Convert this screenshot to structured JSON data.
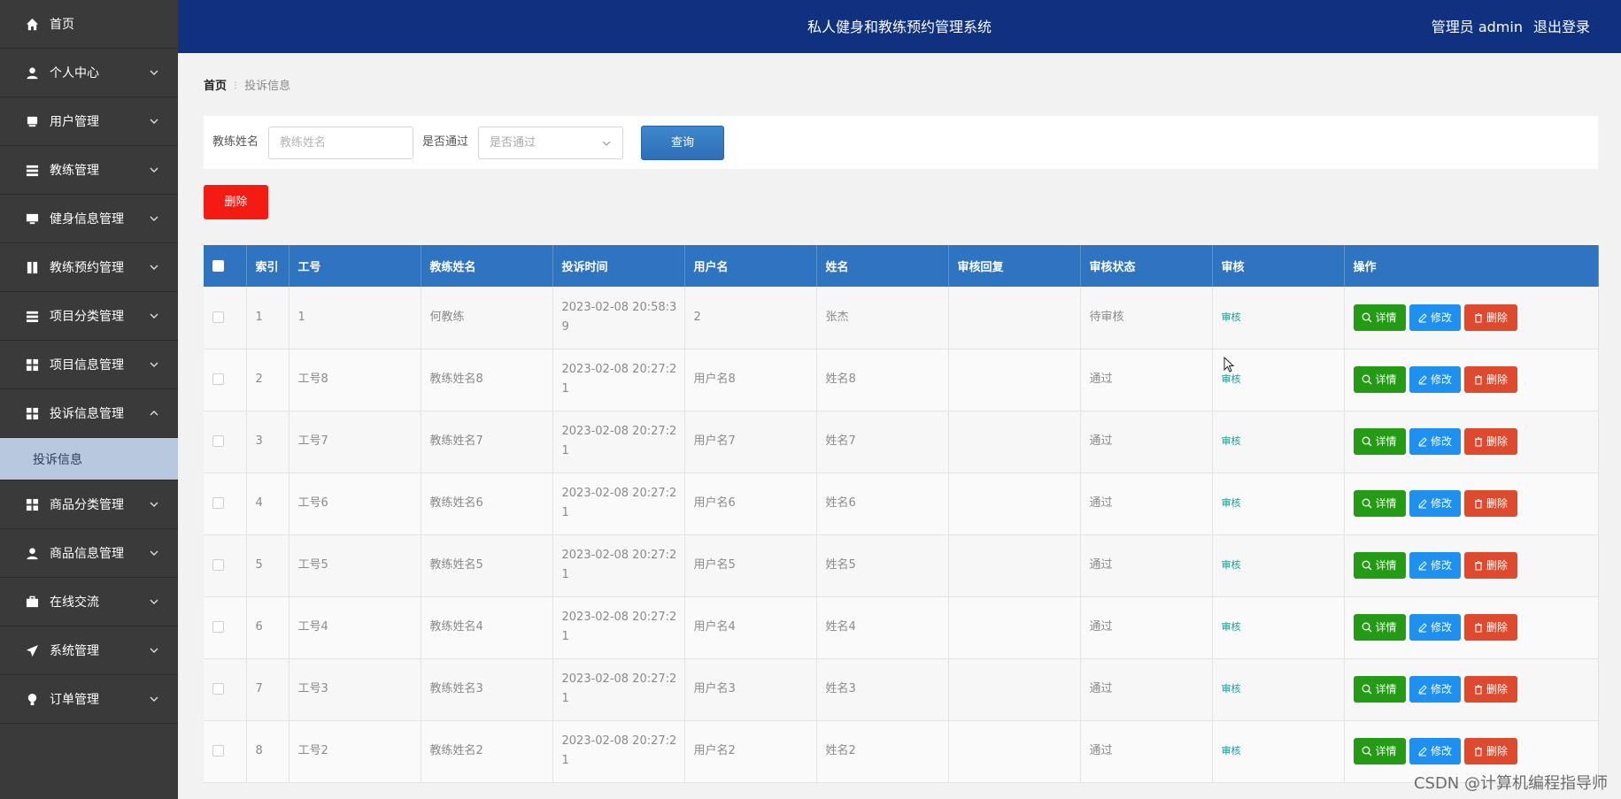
{
  "app": {
    "title": "私人健身和教练预约管理系统",
    "user_label": "管理员 admin",
    "logout_label": "退出登录"
  },
  "sidebar": {
    "items": [
      {
        "label": "首页",
        "icon": "home-icon",
        "has_chevron": false
      },
      {
        "label": "个人中心",
        "icon": "user-icon",
        "has_chevron": true,
        "chevron": "down"
      },
      {
        "label": "用户管理",
        "icon": "users-icon",
        "has_chevron": true,
        "chevron": "down"
      },
      {
        "label": "教练管理",
        "icon": "list-icon",
        "has_chevron": true,
        "chevron": "down"
      },
      {
        "label": "健身信息管理",
        "icon": "monitor-icon",
        "has_chevron": true,
        "chevron": "down"
      },
      {
        "label": "教练预约管理",
        "icon": "calendar-icon",
        "has_chevron": true,
        "chevron": "down"
      },
      {
        "label": "项目分类管理",
        "icon": "list-icon",
        "has_chevron": true,
        "chevron": "down"
      },
      {
        "label": "项目信息管理",
        "icon": "grid-icon",
        "has_chevron": true,
        "chevron": "down"
      },
      {
        "label": "投诉信息管理",
        "icon": "grid-icon",
        "has_chevron": true,
        "chevron": "up"
      },
      {
        "label": "投诉信息",
        "icon": "",
        "sub": true
      },
      {
        "label": "商品分类管理",
        "icon": "grid-icon",
        "has_chevron": true,
        "chevron": "down"
      },
      {
        "label": "商品信息管理",
        "icon": "user-icon",
        "has_chevron": true,
        "chevron": "down"
      },
      {
        "label": "在线交流",
        "icon": "briefcase-icon",
        "has_chevron": true,
        "chevron": "down"
      },
      {
        "label": "系统管理",
        "icon": "send-icon",
        "has_chevron": true,
        "chevron": "down"
      },
      {
        "label": "订单管理",
        "icon": "bulb-icon",
        "has_chevron": true,
        "chevron": "down"
      }
    ]
  },
  "breadcrumb": {
    "home": "首页",
    "current": "投诉信息"
  },
  "search": {
    "name_label": "教练姓名",
    "name_placeholder": "教练姓名",
    "pass_label": "是否通过",
    "pass_placeholder": "是否通过",
    "query_label": "查询"
  },
  "toolbar": {
    "delete_label": "删除"
  },
  "table": {
    "columns": [
      "",
      "索引",
      "工号",
      "教练姓名",
      "投诉时间",
      "用户名",
      "姓名",
      "审核回复",
      "审核状态",
      "审核",
      "操作"
    ],
    "audit_link": "审核",
    "actions": {
      "detail": "详情",
      "edit": "修改",
      "delete": "删除"
    },
    "rows": [
      {
        "index": "1",
        "job_no": "1",
        "coach": "何教练",
        "time_a": "2023-02-08 20:58:3",
        "time_b": "9",
        "username": "2",
        "name": "张杰",
        "reply": "",
        "status": "待审核"
      },
      {
        "index": "2",
        "job_no": "工号8",
        "coach": "教练姓名8",
        "time_a": "2023-02-08 20:27:2",
        "time_b": "1",
        "username": "用户名8",
        "name": "姓名8",
        "reply": "",
        "status": "通过"
      },
      {
        "index": "3",
        "job_no": "工号7",
        "coach": "教练姓名7",
        "time_a": "2023-02-08 20:27:2",
        "time_b": "1",
        "username": "用户名7",
        "name": "姓名7",
        "reply": "",
        "status": "通过"
      },
      {
        "index": "4",
        "job_no": "工号6",
        "coach": "教练姓名6",
        "time_a": "2023-02-08 20:27:2",
        "time_b": "1",
        "username": "用户名6",
        "name": "姓名6",
        "reply": "",
        "status": "通过"
      },
      {
        "index": "5",
        "job_no": "工号5",
        "coach": "教练姓名5",
        "time_a": "2023-02-08 20:27:2",
        "time_b": "1",
        "username": "用户名5",
        "name": "姓名5",
        "reply": "",
        "status": "通过"
      },
      {
        "index": "6",
        "job_no": "工号4",
        "coach": "教练姓名4",
        "time_a": "2023-02-08 20:27:2",
        "time_b": "1",
        "username": "用户名4",
        "name": "姓名4",
        "reply": "",
        "status": "通过"
      },
      {
        "index": "7",
        "job_no": "工号3",
        "coach": "教练姓名3",
        "time_a": "2023-02-08 20:27:2",
        "time_b": "1",
        "username": "用户名3",
        "name": "姓名3",
        "reply": "",
        "status": "通过"
      },
      {
        "index": "8",
        "job_no": "工号2",
        "coach": "教练姓名2",
        "time_a": "2023-02-08 20:27:2",
        "time_b": "1",
        "username": "用户名2",
        "name": "姓名2",
        "reply": "",
        "status": "通过"
      }
    ]
  },
  "watermark": "CSDN @计算机编程指导师"
}
